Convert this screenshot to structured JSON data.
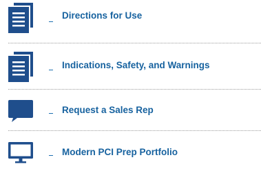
{
  "colors": {
    "icon": "#1f4e8c",
    "link_text": "#17629f",
    "divider": "#9a9a9a"
  },
  "links": [
    {
      "label": "Directions for Use",
      "icon": "document-stack-icon"
    },
    {
      "label": "Indications, Safety, and Warnings",
      "icon": "document-stack-icon"
    },
    {
      "label": "Request a Sales Rep",
      "icon": "speech-bubble-icon"
    },
    {
      "label": "Modern PCI Prep Portfolio",
      "icon": "monitor-icon"
    }
  ]
}
